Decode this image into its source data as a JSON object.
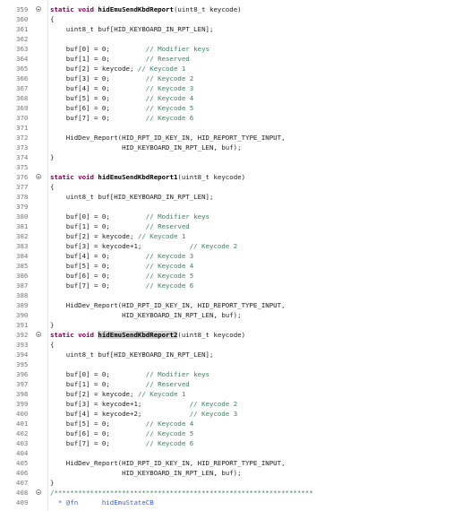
{
  "editor": {
    "lines": [
      {
        "n": "359",
        "fold": true,
        "parts": [
          {
            "t": "static void ",
            "c": "kw"
          },
          {
            "t": "hidEmuSendKbdReport",
            "c": "fn"
          },
          {
            "t": "(uint8_t keycode)"
          }
        ]
      },
      {
        "n": "360",
        "parts": [
          {
            "t": "{"
          }
        ]
      },
      {
        "n": "361",
        "parts": [
          {
            "t": "    uint8_t buf[HID_KEYBOARD_IN_RPT_LEN];"
          }
        ]
      },
      {
        "n": "362",
        "parts": []
      },
      {
        "n": "363",
        "parts": [
          {
            "t": "    buf[0] = 0;         "
          },
          {
            "t": "// Modifier keys",
            "c": "cm"
          }
        ]
      },
      {
        "n": "364",
        "parts": [
          {
            "t": "    buf[1] = 0;         "
          },
          {
            "t": "// Reserved",
            "c": "cm"
          }
        ]
      },
      {
        "n": "365",
        "parts": [
          {
            "t": "    buf[2] = keycode; "
          },
          {
            "t": "// ",
            "c": "cm"
          },
          {
            "t": "Keycode",
            "c": "cm sq"
          },
          {
            "t": " 1",
            "c": "cm"
          }
        ]
      },
      {
        "n": "366",
        "parts": [
          {
            "t": "    buf[3] = 0;         "
          },
          {
            "t": "// ",
            "c": "cm"
          },
          {
            "t": "Keycode",
            "c": "cm sq"
          },
          {
            "t": " 2",
            "c": "cm"
          }
        ]
      },
      {
        "n": "367",
        "parts": [
          {
            "t": "    buf[4] = 0;         "
          },
          {
            "t": "// ",
            "c": "cm"
          },
          {
            "t": "Keycode",
            "c": "cm sq"
          },
          {
            "t": " 3",
            "c": "cm"
          }
        ]
      },
      {
        "n": "368",
        "parts": [
          {
            "t": "    buf[5] = 0;         "
          },
          {
            "t": "// ",
            "c": "cm"
          },
          {
            "t": "Keycode",
            "c": "cm sq"
          },
          {
            "t": " 4",
            "c": "cm"
          }
        ]
      },
      {
        "n": "369",
        "parts": [
          {
            "t": "    buf[6] = 0;         "
          },
          {
            "t": "// ",
            "c": "cm"
          },
          {
            "t": "Keycode",
            "c": "cm sq"
          },
          {
            "t": " 5",
            "c": "cm"
          }
        ]
      },
      {
        "n": "370",
        "parts": [
          {
            "t": "    buf[7] = 0;         "
          },
          {
            "t": "// ",
            "c": "cm"
          },
          {
            "t": "Keycode",
            "c": "cm sq"
          },
          {
            "t": " 6",
            "c": "cm"
          }
        ]
      },
      {
        "n": "371",
        "parts": []
      },
      {
        "n": "372",
        "parts": [
          {
            "t": "    HidDev_Report(HID_RPT_ID_KEY_IN, HID_REPORT_TYPE_INPUT,"
          }
        ]
      },
      {
        "n": "373",
        "parts": [
          {
            "t": "                  HID_KEYBOARD_IN_RPT_LEN, buf);"
          }
        ]
      },
      {
        "n": "374",
        "parts": [
          {
            "t": "}"
          }
        ]
      },
      {
        "n": "375",
        "parts": []
      },
      {
        "n": "376",
        "fold": true,
        "parts": [
          {
            "t": "static void ",
            "c": "kw"
          },
          {
            "t": "hidEmuSendKbdReport1",
            "c": "fn"
          },
          {
            "t": "(uint8_t keycode)"
          }
        ]
      },
      {
        "n": "377",
        "parts": [
          {
            "t": "{"
          }
        ]
      },
      {
        "n": "378",
        "parts": [
          {
            "t": "    uint8_t buf[HID_KEYBOARD_IN_RPT_LEN];"
          }
        ]
      },
      {
        "n": "379",
        "parts": []
      },
      {
        "n": "380",
        "parts": [
          {
            "t": "    buf[0] = 0;         "
          },
          {
            "t": "// Modifier keys",
            "c": "cm"
          }
        ]
      },
      {
        "n": "381",
        "parts": [
          {
            "t": "    buf[1] = 0;         "
          },
          {
            "t": "// Reserved",
            "c": "cm"
          }
        ]
      },
      {
        "n": "382",
        "parts": [
          {
            "t": "    buf[2] = keycode; "
          },
          {
            "t": "// ",
            "c": "cm"
          },
          {
            "t": "Keycode",
            "c": "cm sq"
          },
          {
            "t": " 1",
            "c": "cm"
          }
        ]
      },
      {
        "n": "383",
        "parts": [
          {
            "t": "    buf[3] = keycode+1;            "
          },
          {
            "t": "// ",
            "c": "cm"
          },
          {
            "t": "Keycode",
            "c": "cm sq"
          },
          {
            "t": " 2",
            "c": "cm"
          }
        ]
      },
      {
        "n": "384",
        "parts": [
          {
            "t": "    buf[4] = 0;         "
          },
          {
            "t": "// ",
            "c": "cm"
          },
          {
            "t": "Keycode",
            "c": "cm sq"
          },
          {
            "t": " 3",
            "c": "cm"
          }
        ]
      },
      {
        "n": "385",
        "parts": [
          {
            "t": "    buf[5] = 0;         "
          },
          {
            "t": "// ",
            "c": "cm"
          },
          {
            "t": "Keycode",
            "c": "cm sq"
          },
          {
            "t": " 4",
            "c": "cm"
          }
        ]
      },
      {
        "n": "386",
        "parts": [
          {
            "t": "    buf[6] = 0;         "
          },
          {
            "t": "// ",
            "c": "cm"
          },
          {
            "t": "Keycode",
            "c": "cm sq"
          },
          {
            "t": " 5",
            "c": "cm"
          }
        ]
      },
      {
        "n": "387",
        "parts": [
          {
            "t": "    buf[7] = 0;         "
          },
          {
            "t": "// ",
            "c": "cm"
          },
          {
            "t": "Keycode",
            "c": "cm sq"
          },
          {
            "t": " 6",
            "c": "cm"
          }
        ]
      },
      {
        "n": "388",
        "parts": []
      },
      {
        "n": "389",
        "parts": [
          {
            "t": "    HidDev_Report(HID_RPT_ID_KEY_IN, HID_REPORT_TYPE_INPUT,"
          }
        ]
      },
      {
        "n": "390",
        "parts": [
          {
            "t": "                  HID_KEYBOARD_IN_RPT_LEN, buf);"
          }
        ]
      },
      {
        "n": "391",
        "parts": [
          {
            "t": "}"
          }
        ]
      },
      {
        "n": "392",
        "fold": true,
        "parts": [
          {
            "t": "static void ",
            "c": "kw"
          },
          {
            "t": "hidEmuSendKbdReport2",
            "c": "fn hl"
          },
          {
            "t": "(uint8_t keycode)"
          }
        ]
      },
      {
        "n": "393",
        "parts": [
          {
            "t": "{"
          }
        ]
      },
      {
        "n": "394",
        "parts": [
          {
            "t": "    uint8_t buf[HID_KEYBOARD_IN_RPT_LEN];"
          }
        ]
      },
      {
        "n": "395",
        "parts": []
      },
      {
        "n": "396",
        "parts": [
          {
            "t": "    buf[0] = 0;         "
          },
          {
            "t": "// Modifier keys",
            "c": "cm"
          }
        ]
      },
      {
        "n": "397",
        "parts": [
          {
            "t": "    buf[1] = 0;         "
          },
          {
            "t": "// Reserved",
            "c": "cm"
          }
        ]
      },
      {
        "n": "398",
        "parts": [
          {
            "t": "    buf[2] = keycode; "
          },
          {
            "t": "// ",
            "c": "cm"
          },
          {
            "t": "Keycode",
            "c": "cm sq"
          },
          {
            "t": " 1",
            "c": "cm"
          }
        ]
      },
      {
        "n": "399",
        "parts": [
          {
            "t": "    buf[3] = keycode+1;            "
          },
          {
            "t": "// ",
            "c": "cm"
          },
          {
            "t": "Keycode",
            "c": "cm sq"
          },
          {
            "t": " 2",
            "c": "cm"
          }
        ]
      },
      {
        "n": "400",
        "parts": [
          {
            "t": "    buf[4] = keycode+2;            "
          },
          {
            "t": "// ",
            "c": "cm"
          },
          {
            "t": "Keycode",
            "c": "cm sq"
          },
          {
            "t": " 3",
            "c": "cm"
          }
        ]
      },
      {
        "n": "401",
        "parts": [
          {
            "t": "    buf[5] = 0;         "
          },
          {
            "t": "// ",
            "c": "cm"
          },
          {
            "t": "Keycode",
            "c": "cm sq"
          },
          {
            "t": " 4",
            "c": "cm"
          }
        ]
      },
      {
        "n": "402",
        "parts": [
          {
            "t": "    buf[6] = 0;         "
          },
          {
            "t": "// ",
            "c": "cm"
          },
          {
            "t": "Keycode",
            "c": "cm sq"
          },
          {
            "t": " 5",
            "c": "cm"
          }
        ]
      },
      {
        "n": "403",
        "parts": [
          {
            "t": "    buf[7] = 0;         "
          },
          {
            "t": "// ",
            "c": "cm"
          },
          {
            "t": "Keycode",
            "c": "cm sq"
          },
          {
            "t": " 6",
            "c": "cm"
          }
        ]
      },
      {
        "n": "404",
        "parts": []
      },
      {
        "n": "405",
        "parts": [
          {
            "t": "    HidDev_Report(HID_RPT_ID_KEY_IN, HID_REPORT_TYPE_INPUT,"
          }
        ]
      },
      {
        "n": "406",
        "parts": [
          {
            "t": "                  HID_KEYBOARD_IN_RPT_LEN, buf);"
          }
        ]
      },
      {
        "n": "407",
        "parts": [
          {
            "t": "}"
          }
        ]
      },
      {
        "n": "408",
        "fold": true,
        "parts": [
          {
            "t": "/*****************************************************************",
            "c": "stars"
          }
        ]
      },
      {
        "n": "409",
        "parts": [
          {
            "t": "  * @fn      hidEmuStateCB",
            "c": "doc"
          }
        ]
      }
    ]
  }
}
